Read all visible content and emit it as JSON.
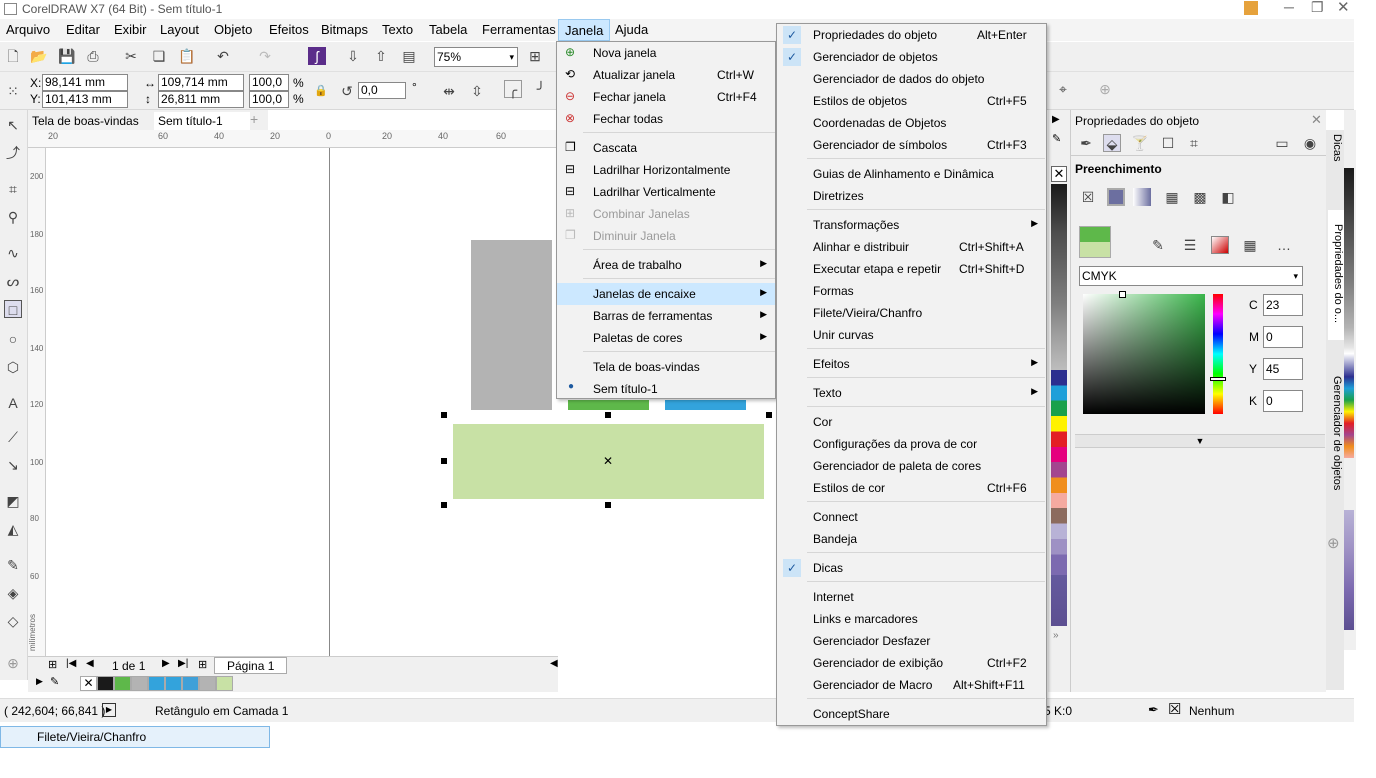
{
  "window": {
    "title": "CorelDRAW X7 (64 Bit) - Sem título-1"
  },
  "menubar": [
    "Arquivo",
    "Editar",
    "Exibir",
    "Layout",
    "Objeto",
    "Efeitos",
    "Bitmaps",
    "Texto",
    "Tabela",
    "Ferramentas",
    "Janela",
    "Ajuda"
  ],
  "toolbar": {
    "zoom": "75%"
  },
  "propbar": {
    "x_label": "X:",
    "x": "98,141 mm",
    "y_label": "Y:",
    "y": "101,413 mm",
    "w": "109,714 mm",
    "h": "26,811 mm",
    "sx": "100,0",
    "sy": "100,0",
    "pct": "%",
    "rotation": "0,0",
    "deg": "°"
  },
  "doc_tabs": [
    "Tela de boas-vindas",
    "Sem título-1"
  ],
  "ruler": {
    "h_ticks": [
      "20",
      "0",
      "20",
      "40",
      "60"
    ],
    "v_ticks": [
      "200",
      "180",
      "160",
      "140",
      "120",
      "100",
      "80",
      "60"
    ],
    "unit": "milímetros"
  },
  "pagebar": {
    "page_count": "1 de 1",
    "page_tab": "Página 1"
  },
  "statusbar": {
    "coords": "( 242,604; 66,841 )",
    "object_info": "Retângulo em Camada 1",
    "color_info": "5 K:0",
    "fill": "Nenhum"
  },
  "tooltip": "Filete/Vieira/Chanfro",
  "janela_menu": {
    "items": [
      {
        "label": "Nova janela",
        "shortcut": ""
      },
      {
        "label": "Atualizar janela",
        "shortcut": "Ctrl+W"
      },
      {
        "label": "Fechar janela",
        "shortcut": "Ctrl+F4"
      },
      {
        "label": "Fechar todas",
        "shortcut": ""
      },
      {
        "label": "Cascata",
        "shortcut": ""
      },
      {
        "label": "Ladrilhar Horizontalmente",
        "shortcut": ""
      },
      {
        "label": "Ladrilhar Verticalmente",
        "shortcut": ""
      },
      {
        "label": "Combinar Janelas",
        "shortcut": ""
      },
      {
        "label": "Diminuir Janela",
        "shortcut": ""
      },
      {
        "label": "Área de trabalho",
        "shortcut": ""
      },
      {
        "label": "Janelas de encaixe",
        "shortcut": ""
      },
      {
        "label": "Barras de ferramentas",
        "shortcut": ""
      },
      {
        "label": "Paletas de cores",
        "shortcut": ""
      },
      {
        "label": "Tela de boas-vindas",
        "shortcut": ""
      },
      {
        "label": "Sem título-1",
        "shortcut": ""
      }
    ]
  },
  "docker_menu": {
    "items": [
      {
        "label": "Propriedades do objeto",
        "shortcut": "Alt+Enter"
      },
      {
        "label": "Gerenciador de objetos",
        "shortcut": ""
      },
      {
        "label": "Gerenciador de dados do objeto",
        "shortcut": ""
      },
      {
        "label": "Estilos de objetos",
        "shortcut": "Ctrl+F5"
      },
      {
        "label": "Coordenadas de Objetos",
        "shortcut": ""
      },
      {
        "label": "Gerenciador de símbolos",
        "shortcut": "Ctrl+F3"
      },
      {
        "label": "Guias de Alinhamento e Dinâmica",
        "shortcut": ""
      },
      {
        "label": "Diretrizes",
        "shortcut": ""
      },
      {
        "label": "Transformações",
        "shortcut": ""
      },
      {
        "label": "Alinhar e distribuir",
        "shortcut": "Ctrl+Shift+A"
      },
      {
        "label": "Executar etapa e repetir",
        "shortcut": "Ctrl+Shift+D"
      },
      {
        "label": "Formas",
        "shortcut": ""
      },
      {
        "label": "Filete/Vieira/Chanfro",
        "shortcut": ""
      },
      {
        "label": "Unir curvas",
        "shortcut": ""
      },
      {
        "label": "Efeitos",
        "shortcut": ""
      },
      {
        "label": "Texto",
        "shortcut": ""
      },
      {
        "label": "Cor",
        "shortcut": ""
      },
      {
        "label": "Configurações da prova de cor",
        "shortcut": ""
      },
      {
        "label": "Gerenciador de paleta de cores",
        "shortcut": ""
      },
      {
        "label": "Estilos de cor",
        "shortcut": "Ctrl+F6"
      },
      {
        "label": "Connect",
        "shortcut": ""
      },
      {
        "label": "Bandeja",
        "shortcut": ""
      },
      {
        "label": "Dicas",
        "shortcut": ""
      },
      {
        "label": "Internet",
        "shortcut": ""
      },
      {
        "label": "Links e marcadores",
        "shortcut": ""
      },
      {
        "label": "Gerenciador Desfazer",
        "shortcut": ""
      },
      {
        "label": "Gerenciador de exibição",
        "shortcut": "Ctrl+F2"
      },
      {
        "label": "Gerenciador de Macro",
        "shortcut": "Alt+Shift+F11"
      },
      {
        "label": "ConceptShare",
        "shortcut": ""
      }
    ]
  },
  "docker_panel": {
    "title": "Propriedades do objeto",
    "section": "Preenchimento",
    "color_model": "CMYK",
    "cmyk": [
      {
        "label": "C",
        "value": "23"
      },
      {
        "label": "M",
        "value": "0"
      },
      {
        "label": "Y",
        "value": "45"
      },
      {
        "label": "K",
        "value": "0"
      }
    ],
    "side_tabs": [
      "Dicas",
      "Propriedades do o...",
      "Gerenciador de objetos"
    ]
  },
  "colors": {
    "selected_rect": "#c8e1a5",
    "gray_rect": "#b3b3b3",
    "green_bar": "#5eb84a",
    "blue_bar": "#33a3dc",
    "menu_highlight": "#cce8ff"
  }
}
